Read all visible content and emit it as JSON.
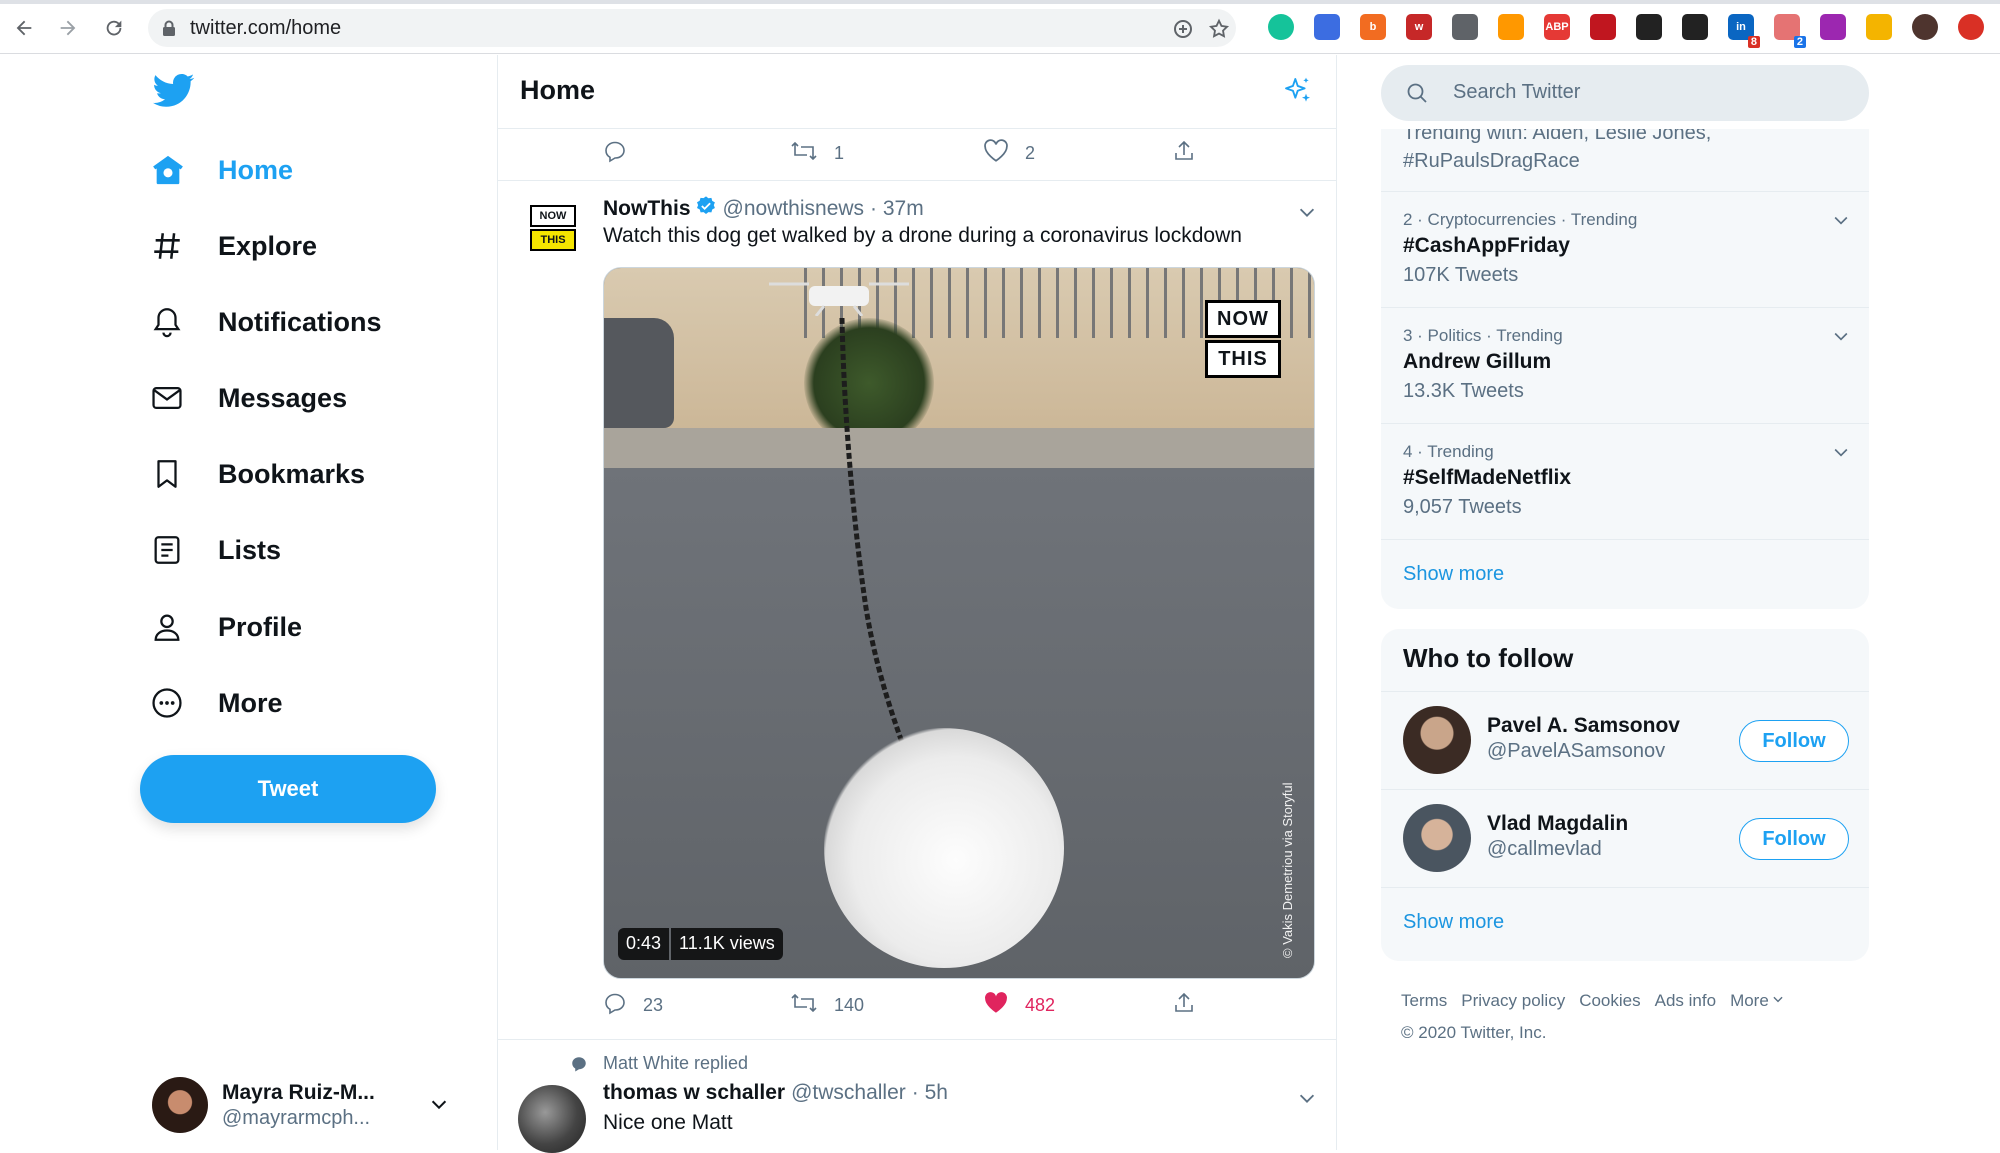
{
  "browser": {
    "url": "twitter.com/home",
    "extensions": [
      {
        "name": "grammarly",
        "color": "#15c39a",
        "text": ""
      },
      {
        "name": "cap",
        "color": "#3c6de1",
        "text": ""
      },
      {
        "name": "honey",
        "color": "#f26c21",
        "text": "b"
      },
      {
        "name": "w-ext",
        "color": "#c62828",
        "text": "w"
      },
      {
        "name": "play",
        "color": "#5f6368",
        "text": ""
      },
      {
        "name": "rainbow",
        "color": "#ff9800",
        "text": ""
      },
      {
        "name": "adblock-plus",
        "color": "#e53935",
        "text": "ABP"
      },
      {
        "name": "ublock",
        "color": "#c0161f",
        "text": ""
      },
      {
        "name": "tracker",
        "color": "#222",
        "text": ""
      },
      {
        "name": "stats",
        "color": "#222",
        "text": ""
      },
      {
        "name": "linkedin",
        "color": "#0a66c2",
        "text": "in",
        "badge": "8",
        "badgecolor": "#d93025"
      },
      {
        "name": "share",
        "color": "#e57373",
        "text": "",
        "badge": "2",
        "badgecolor": "#1a73e8"
      },
      {
        "name": "colors",
        "color": "#9c27b0",
        "text": ""
      },
      {
        "name": "analytics",
        "color": "#f4b400",
        "text": ""
      },
      {
        "name": "profile",
        "color": "#4e342e",
        "text": ""
      },
      {
        "name": "menu-red",
        "color": "#d93025",
        "text": ""
      }
    ]
  },
  "nav": {
    "items": [
      {
        "label": "Home",
        "icon": "home-icon",
        "active": true
      },
      {
        "label": "Explore",
        "icon": "hashtag-icon"
      },
      {
        "label": "Notifications",
        "icon": "bell-icon"
      },
      {
        "label": "Messages",
        "icon": "envelope-icon"
      },
      {
        "label": "Bookmarks",
        "icon": "bookmark-icon"
      },
      {
        "label": "Lists",
        "icon": "list-icon"
      },
      {
        "label": "Profile",
        "icon": "person-icon"
      },
      {
        "label": "More",
        "icon": "more-icon"
      }
    ],
    "tweet_button": "Tweet",
    "account": {
      "name": "Mayra Ruiz-M...",
      "handle": "@mayrarmcph..."
    }
  },
  "main": {
    "title": "Home",
    "prev_actions": {
      "reply": "",
      "retweet": "1",
      "like": "2"
    },
    "tweet": {
      "avatar_top": "NOW",
      "avatar_bottom": "THIS",
      "name": "NowThis",
      "handle": "@nowthisnews",
      "time": "· 37m",
      "text": "Watch this dog get walked by a drone during a coronavirus lockdown",
      "media": {
        "logo_top": "NOW",
        "logo_bottom": "THIS",
        "credit": "© Vakis Demetriou via Storyful",
        "duration": "0:43",
        "views": "11.1K views"
      },
      "actions": {
        "reply": "23",
        "retweet": "140",
        "like": "482"
      },
      "like_color": "#e0245e"
    },
    "tweet2": {
      "context": "Matt White replied",
      "name": "thomas w schaller",
      "handle": "@twschaller",
      "time": "· 5h",
      "text": "Nice one Matt"
    }
  },
  "right": {
    "search_placeholder": "Search Twitter",
    "trend_cut": "Trending with: Alden, Leslie Jones,\n#RuPaulsDragRace",
    "trends": [
      {
        "meta": "2 · Cryptocurrencies · Trending",
        "topic": "#CashAppFriday",
        "count": "107K Tweets"
      },
      {
        "meta": "3 · Politics · Trending",
        "topic": "Andrew Gillum",
        "count": "13.3K Tweets"
      },
      {
        "meta": "4 · Trending",
        "topic": "#SelfMadeNetflix",
        "count": "9,057 Tweets"
      }
    ],
    "trends_show_more": "Show more",
    "who_to_follow": {
      "title": "Who to follow",
      "people": [
        {
          "name": "Pavel A. Samsonov",
          "handle": "@PavelASamsonov",
          "button": "Follow"
        },
        {
          "name": "Vlad Magdalin",
          "handle": "@callmevlad",
          "button": "Follow"
        }
      ],
      "show_more": "Show more"
    },
    "footer": {
      "links": [
        "Terms",
        "Privacy policy",
        "Cookies",
        "Ads info",
        "More"
      ],
      "copyright": "© 2020 Twitter, Inc."
    }
  },
  "colors": {
    "accent": "#1da1f2",
    "border": "#e6ecf0",
    "muted": "#5b7083"
  }
}
